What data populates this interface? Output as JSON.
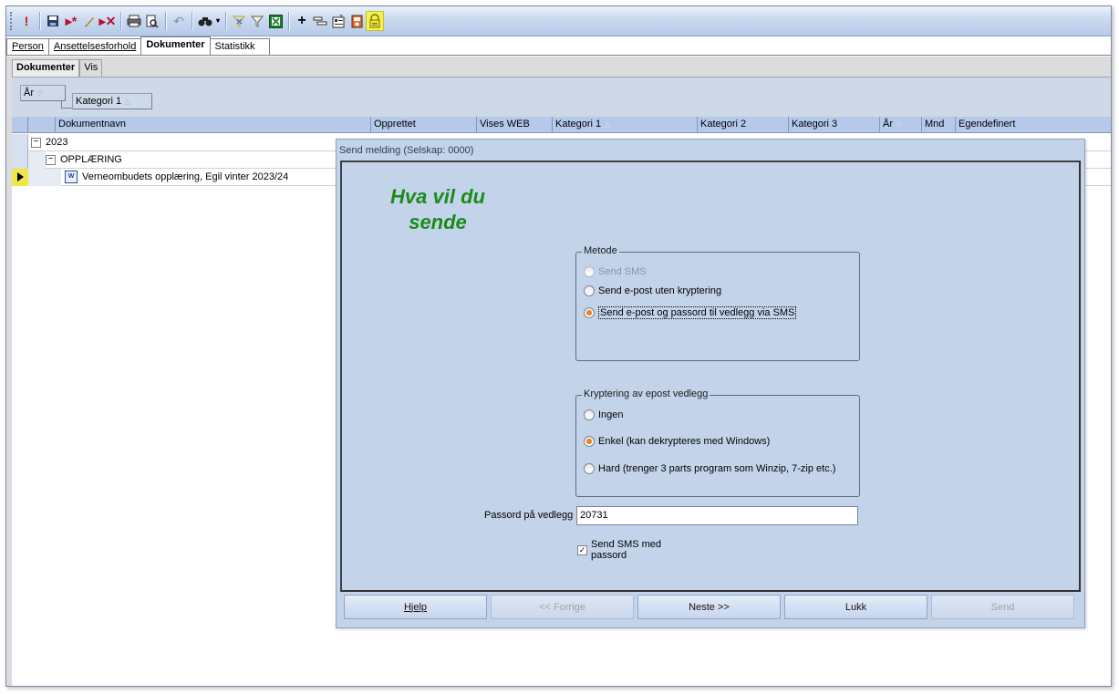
{
  "toolbar": {
    "buttons": [
      "exclamation-icon",
      "save-icon",
      "new-record-icon",
      "edit-icon",
      "delete-icon",
      "print-icon",
      "print-preview-icon",
      "undo-icon",
      "search-icon",
      "filter-clear-icon",
      "filter-icon",
      "excel-icon",
      "add-icon",
      "fields-icon",
      "properties-icon",
      "report-icon",
      "message-icon"
    ]
  },
  "tabs": [
    "Person",
    "Ansettelsesforhold",
    "Dokumenter",
    "Statistikk"
  ],
  "subtabs": [
    "Dokumenter",
    "Vis"
  ],
  "group_by": {
    "first": "År",
    "second": "Kategori 1"
  },
  "grid": {
    "columns": [
      "Dokumentnavn",
      "Opprettet",
      "Vises WEB",
      "Kategori 1",
      "Kategori 2",
      "Kategori 3",
      "År",
      "Mnd",
      "Egendefinert"
    ],
    "group_year": "2023",
    "group_category": "OPPLÆRING",
    "row_name": "Verneombudets opplæring, Egil vinter 2023/24",
    "expand_symbol": "−",
    "doc_icon_text": "W"
  },
  "dialog": {
    "title": "Send melding (Selskap: 0000)",
    "heading": "Hva vil du sende",
    "method_legend": "Metode",
    "method_options": [
      "Send SMS",
      "Send e-post uten kryptering",
      "Send e-post og  passord til vedlegg via SMS"
    ],
    "encryption_legend": "Kryptering av epost vedlegg",
    "encryption_options": [
      "Ingen",
      "Enkel (kan dekrypteres med Windows)",
      "Hard (trenger 3 parts program som Winzip, 7-zip etc.)"
    ],
    "password_label": "Passord på vedlegg",
    "password_value": "20731",
    "sms_checkbox_label": "Send SMS med passord",
    "sms_checkbox_checked": true,
    "buttons": [
      "Hjelp",
      "<< Forrige",
      "Neste >>",
      "Lukk",
      "Send"
    ]
  },
  "colors": {
    "heading": "#1c8a1c",
    "dialog_bg": "#c3d4ea",
    "toolbar_highlight": "#f4f24d"
  }
}
